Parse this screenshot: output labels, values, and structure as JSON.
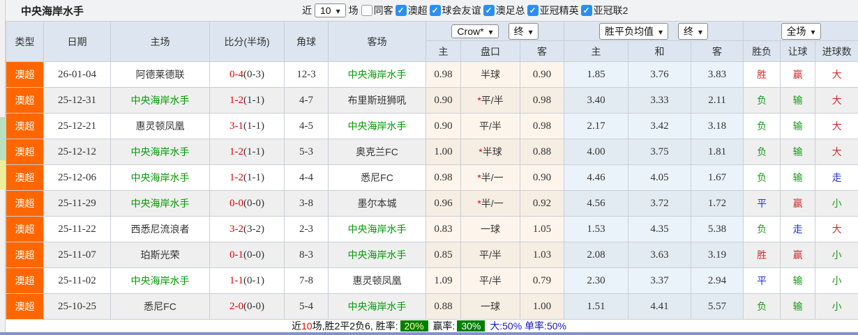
{
  "title": "中央海岸水手",
  "topbar": {
    "recent_label": "近",
    "recent_value": "10",
    "matches_label": "场",
    "checkboxes": [
      {
        "label": "同客",
        "checked": false
      },
      {
        "label": "澳超",
        "checked": true
      },
      {
        "label": "球会友谊",
        "checked": true
      },
      {
        "label": "澳足总",
        "checked": true
      },
      {
        "label": "亚冠精英",
        "checked": true
      },
      {
        "label": "亚冠联2",
        "checked": true
      }
    ]
  },
  "table": {
    "main_headers": [
      "类型",
      "日期",
      "主场",
      "比分(半场)",
      "角球",
      "客场"
    ],
    "dropdowns": {
      "odds_company": "Crow*",
      "odds_stage": "终",
      "avg_type": "胜平负均值",
      "avg_stage": "终",
      "scope": "全场"
    },
    "sub_headers": [
      "主",
      "盘口",
      "客",
      "主",
      "和",
      "客",
      "胜负",
      "让球",
      "进球数"
    ],
    "highlight_team": "中央海岸水手",
    "rows": [
      {
        "league": "澳超",
        "date": "26-01-04",
        "home": "阿德莱德联",
        "score_ft": "0-4",
        "score_ht": "(0-3)",
        "corner": "12-3",
        "away": "中央海岸水手",
        "odds_home": "0.98",
        "handicap": "半球",
        "odds_away": "0.90",
        "avg_win": "1.85",
        "avg_draw": "3.76",
        "avg_lose": "3.83",
        "result": "胜",
        "result_color": "red",
        "handicap_result": "赢",
        "handicap_result_color": "red",
        "goals": "大",
        "goals_color": "red"
      },
      {
        "league": "澳超",
        "date": "25-12-31",
        "home": "中央海岸水手",
        "score_ft": "1-2",
        "score_ht": "(1-1)",
        "corner": "4-7",
        "away": "布里斯班狮吼",
        "odds_home": "0.90",
        "handicap": "*平/半",
        "odds_away": "0.98",
        "avg_win": "3.40",
        "avg_draw": "3.33",
        "avg_lose": "2.11",
        "result": "负",
        "result_color": "green",
        "handicap_result": "输",
        "handicap_result_color": "green",
        "goals": "大",
        "goals_color": "red"
      },
      {
        "league": "澳超",
        "date": "25-12-21",
        "home": "惠灵顿凤凰",
        "score_ft": "3-1",
        "score_ht": "(1-1)",
        "corner": "4-5",
        "away": "中央海岸水手",
        "odds_home": "0.90",
        "handicap": "平/半",
        "odds_away": "0.98",
        "avg_win": "2.17",
        "avg_draw": "3.42",
        "avg_lose": "3.18",
        "result": "负",
        "result_color": "green",
        "handicap_result": "输",
        "handicap_result_color": "green",
        "goals": "大",
        "goals_color": "red"
      },
      {
        "league": "澳超",
        "date": "25-12-12",
        "home": "中央海岸水手",
        "score_ft": "1-2",
        "score_ht": "(1-1)",
        "corner": "5-3",
        "away": "奥克兰FC",
        "odds_home": "1.00",
        "handicap": "*半球",
        "odds_away": "0.88",
        "avg_win": "4.00",
        "avg_draw": "3.75",
        "avg_lose": "1.81",
        "result": "负",
        "result_color": "green",
        "handicap_result": "输",
        "handicap_result_color": "green",
        "goals": "大",
        "goals_color": "red"
      },
      {
        "league": "澳超",
        "date": "25-12-06",
        "home": "中央海岸水手",
        "score_ft": "1-2",
        "score_ht": "(1-1)",
        "corner": "4-4",
        "away": "悉尼FC",
        "odds_home": "0.98",
        "handicap": "*半/一",
        "odds_away": "0.90",
        "avg_win": "4.46",
        "avg_draw": "4.05",
        "avg_lose": "1.67",
        "result": "负",
        "result_color": "green",
        "handicap_result": "输",
        "handicap_result_color": "green",
        "goals": "走",
        "goals_color": "blue"
      },
      {
        "league": "澳超",
        "date": "25-11-29",
        "home": "中央海岸水手",
        "score_ft": "0-0",
        "score_ht": "(0-0)",
        "corner": "3-8",
        "away": "墨尔本城",
        "odds_home": "0.96",
        "handicap": "*半/一",
        "odds_away": "0.92",
        "avg_win": "4.56",
        "avg_draw": "3.72",
        "avg_lose": "1.72",
        "result": "平",
        "result_color": "blue",
        "handicap_result": "赢",
        "handicap_result_color": "red",
        "goals": "小",
        "goals_color": "green"
      },
      {
        "league": "澳超",
        "date": "25-11-22",
        "home": "西悉尼流浪者",
        "score_ft": "3-2",
        "score_ht": "(3-2)",
        "corner": "2-3",
        "away": "中央海岸水手",
        "odds_home": "0.83",
        "handicap": "一球",
        "odds_away": "1.05",
        "avg_win": "1.53",
        "avg_draw": "4.35",
        "avg_lose": "5.38",
        "result": "负",
        "result_color": "green",
        "handicap_result": "走",
        "handicap_result_color": "blue",
        "goals": "大",
        "goals_color": "red"
      },
      {
        "league": "澳超",
        "date": "25-11-07",
        "home": "珀斯光荣",
        "score_ft": "0-1",
        "score_ht": "(0-0)",
        "corner": "8-3",
        "away": "中央海岸水手",
        "odds_home": "0.85",
        "handicap": "平/半",
        "odds_away": "1.03",
        "avg_win": "2.08",
        "avg_draw": "3.63",
        "avg_lose": "3.19",
        "result": "胜",
        "result_color": "red",
        "handicap_result": "赢",
        "handicap_result_color": "red",
        "goals": "小",
        "goals_color": "green"
      },
      {
        "league": "澳超",
        "date": "25-11-02",
        "home": "中央海岸水手",
        "score_ft": "1-1",
        "score_ht": "(0-1)",
        "corner": "7-8",
        "away": "惠灵顿凤凰",
        "odds_home": "1.09",
        "handicap": "平/半",
        "odds_away": "0.79",
        "avg_win": "2.30",
        "avg_draw": "3.37",
        "avg_lose": "2.94",
        "result": "平",
        "result_color": "blue",
        "handicap_result": "输",
        "handicap_result_color": "green",
        "goals": "小",
        "goals_color": "green"
      },
      {
        "league": "澳超",
        "date": "25-10-25",
        "home": "悉尼FC",
        "score_ft": "2-0",
        "score_ht": "(0-0)",
        "corner": "5-4",
        "away": "中央海岸水手",
        "odds_home": "0.88",
        "handicap": "一球",
        "odds_away": "1.00",
        "avg_win": "1.51",
        "avg_draw": "4.41",
        "avg_lose": "5.57",
        "result": "负",
        "result_color": "green",
        "handicap_result": "输",
        "handicap_result_color": "green",
        "goals": "小",
        "goals_color": "green"
      }
    ]
  },
  "footer": {
    "part1": "近",
    "count": "10",
    "part2": "场,胜2平2负6, 胜率:",
    "win_rate": "20%",
    "part3": "赢率:",
    "handicap_rate": "30%",
    "part4": "大:50% 单率:50%"
  },
  "colors": {
    "league_orange": "#ff6600",
    "team_green": "#009900",
    "score_red": "#e60000",
    "badge_green": "#008000",
    "checkbox_blue": "#2a8ff2",
    "result_red": "#d42a2a",
    "result_green": "#1a9a1a",
    "result_blue": "#2233cc"
  }
}
